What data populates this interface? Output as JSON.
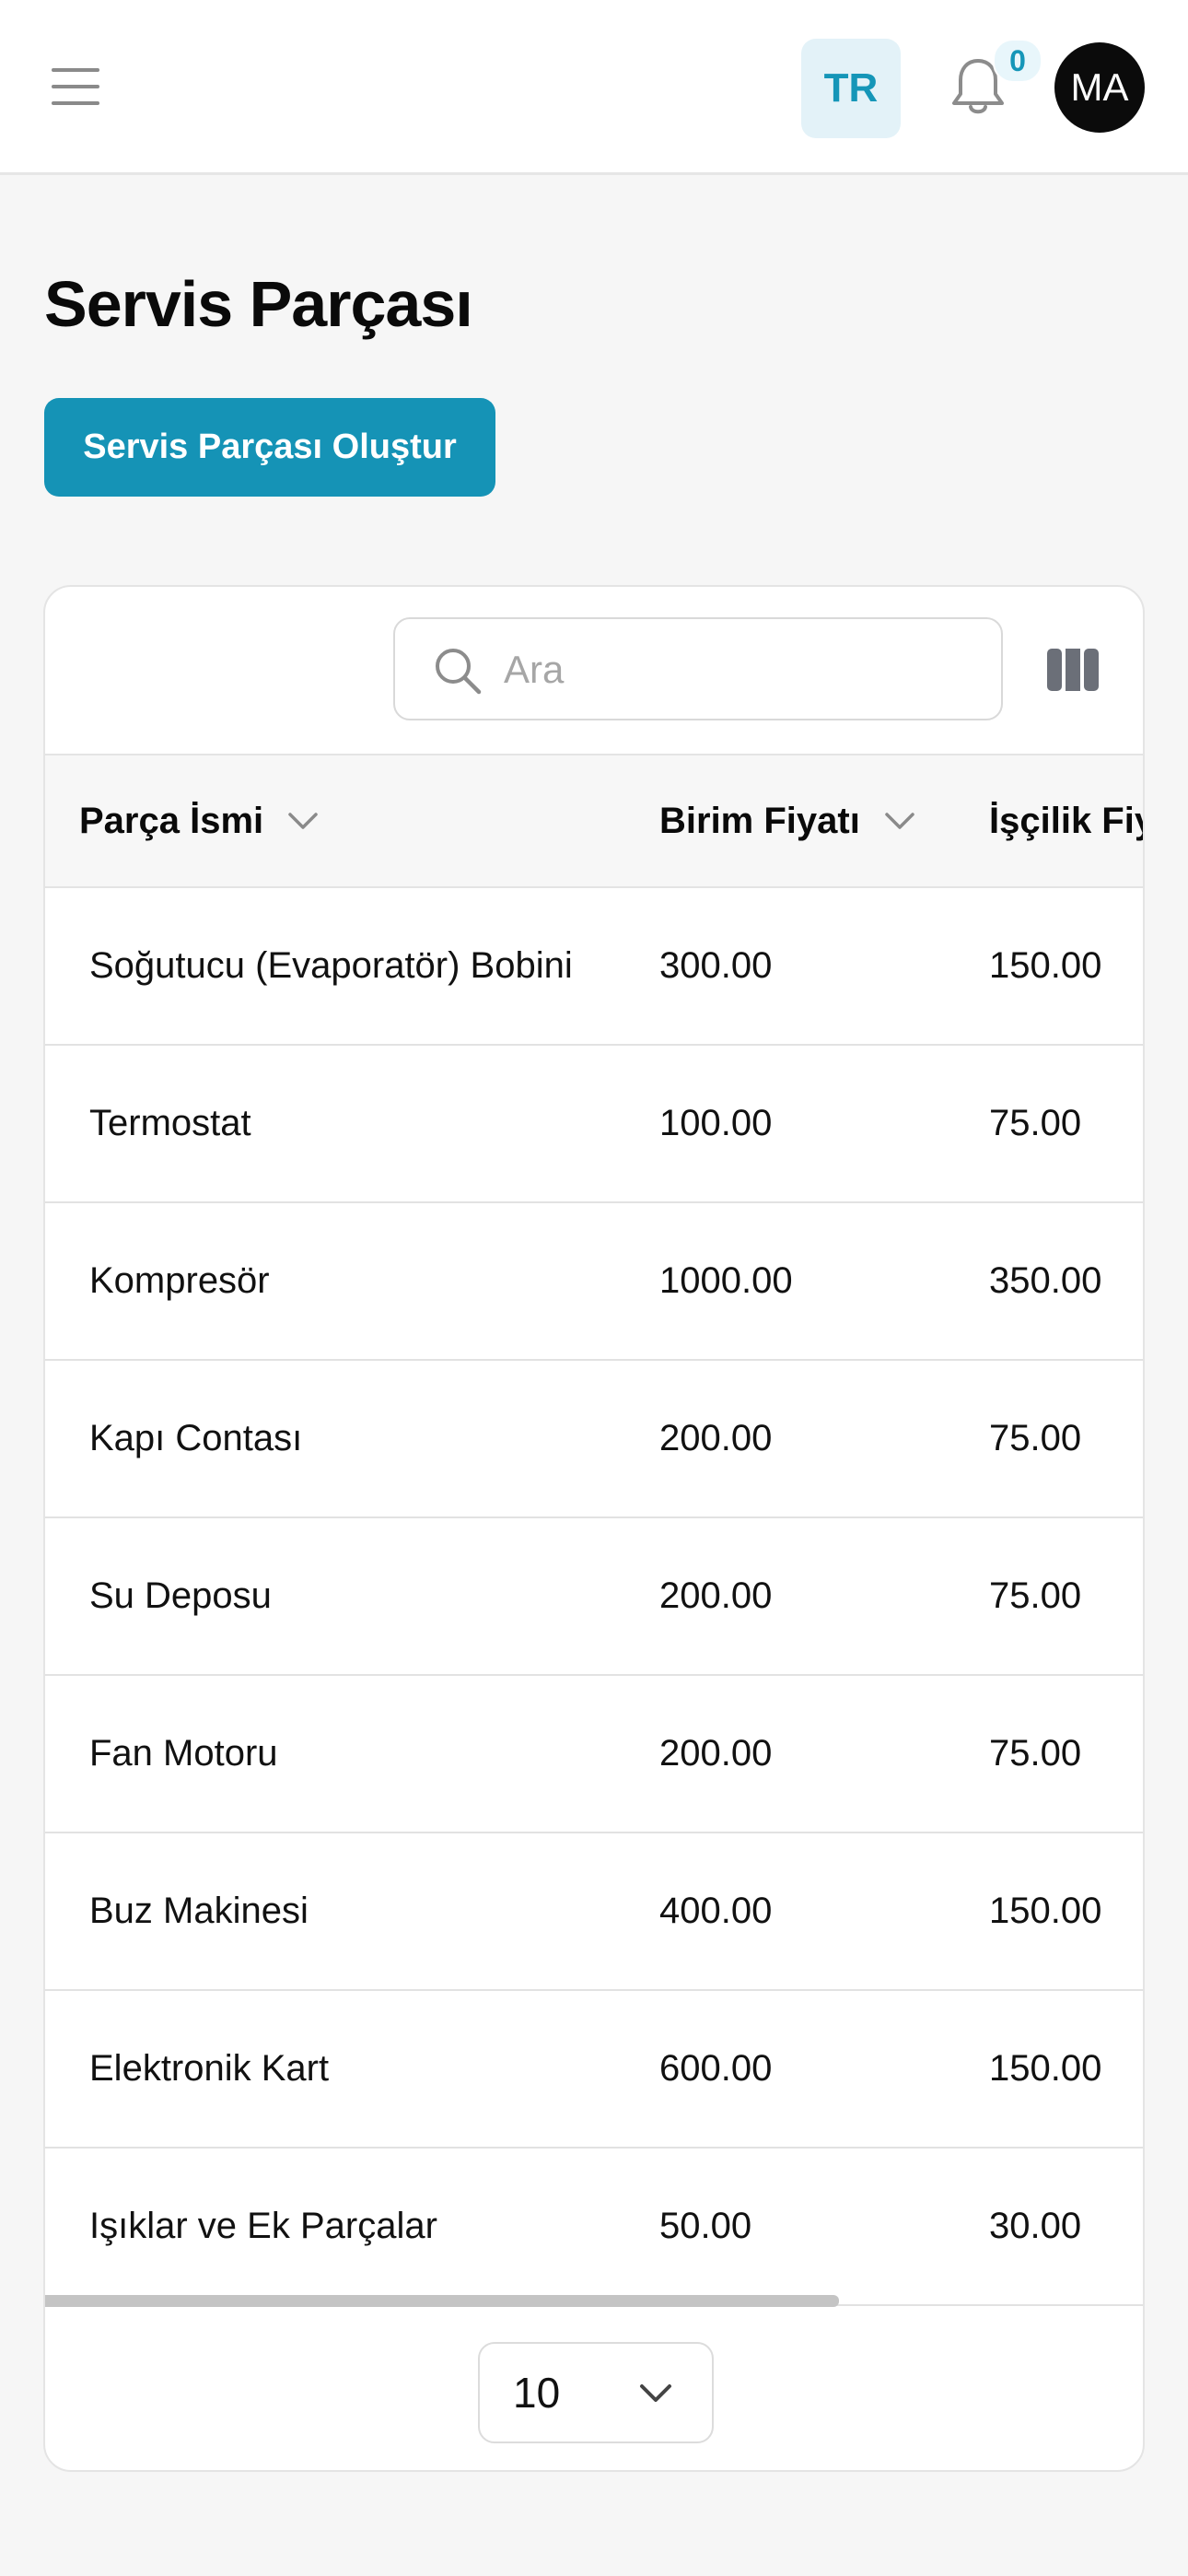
{
  "header": {
    "language": "TR",
    "notification_count": "0",
    "avatar_initials": "MA"
  },
  "page": {
    "title": "Servis Parçası",
    "create_button": "Servis Parçası Oluştur"
  },
  "search": {
    "placeholder": "Ara"
  },
  "table": {
    "columns": [
      "Parça İsmi",
      "Birim Fiyatı",
      "İşçilik Fiyatı"
    ],
    "rows": [
      [
        "Soğutucu (Evaporatör) Bobini",
        "300.00",
        "150.00"
      ],
      [
        "Termostat",
        "100.00",
        "75.00"
      ],
      [
        "Kompresör",
        "1000.00",
        "350.00"
      ],
      [
        "Kapı Contası",
        "200.00",
        "75.00"
      ],
      [
        "Su Deposu",
        "200.00",
        "75.00"
      ],
      [
        "Fan Motoru",
        "200.00",
        "75.00"
      ],
      [
        "Buz Makinesi",
        "400.00",
        "150.00"
      ],
      [
        "Elektronik Kart",
        "600.00",
        "150.00"
      ],
      [
        "Işıklar ve Ek Parçalar",
        "50.00",
        "30.00"
      ]
    ]
  },
  "pagination": {
    "page_size": "10"
  },
  "colors": {
    "accent": "#1593b6",
    "lang_bg": "#e3f2f8"
  }
}
